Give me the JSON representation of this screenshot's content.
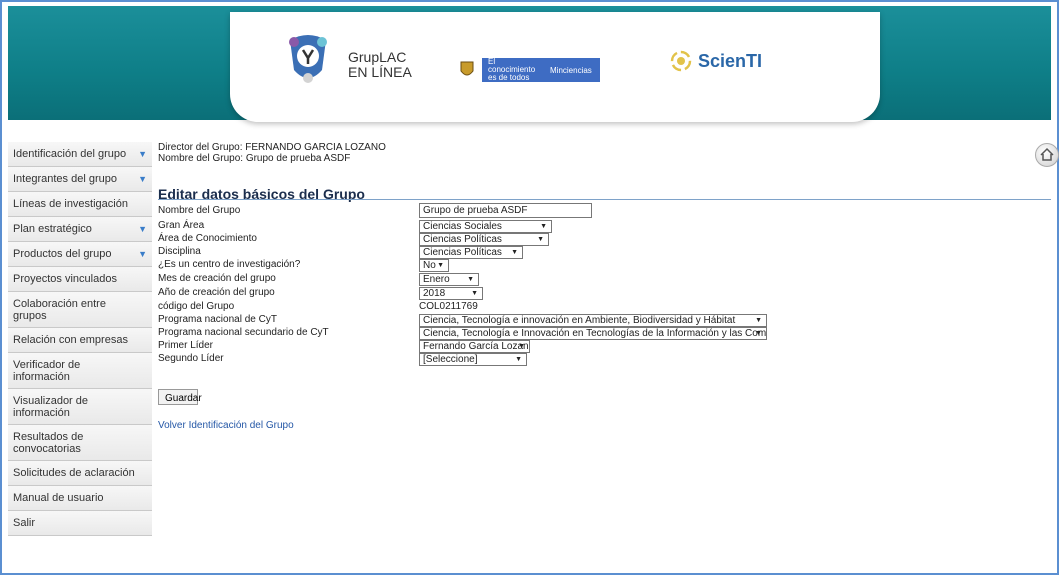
{
  "header": {
    "app_line1": "GrupLAC",
    "app_line2": "EN LÍNEA",
    "gov_slogan": "El conocimiento es de todos",
    "gov_ministry": "Minciencias",
    "scienti_name": "ScienTI"
  },
  "sidebar": {
    "items": [
      {
        "label": "Identificación del grupo",
        "has_chevron": true
      },
      {
        "label": "Integrantes del grupo",
        "has_chevron": true
      },
      {
        "label": "Líneas de investigación",
        "has_chevron": false
      },
      {
        "label": "Plan estratégico",
        "has_chevron": true
      },
      {
        "label": "Productos del grupo",
        "has_chevron": true
      },
      {
        "label": "Proyectos vinculados",
        "has_chevron": false
      },
      {
        "label": "Colaboración entre grupos",
        "has_chevron": false
      },
      {
        "label": "Relación con empresas",
        "has_chevron": false
      },
      {
        "label": "Verificador de información",
        "has_chevron": false
      },
      {
        "label": "Visualizador de información",
        "has_chevron": false
      },
      {
        "label": "Resultados de convocatorias",
        "has_chevron": false
      },
      {
        "label": "Solicitudes de aclaración",
        "has_chevron": false
      },
      {
        "label": "Manual de usuario",
        "has_chevron": false
      },
      {
        "label": "Salir",
        "has_chevron": false
      }
    ]
  },
  "group_info": {
    "director_label": "Director del Grupo:",
    "director_value": "FERNANDO GARCIA LOZANO",
    "name_label": "Nombre del Grupo:",
    "name_value": "Grupo de prueba ASDF"
  },
  "form": {
    "title": "Editar datos básicos del Grupo",
    "fields": {
      "nombre": {
        "label": "Nombre del Grupo",
        "value": "Grupo de prueba ASDF"
      },
      "gran_area": {
        "label": "Gran Área",
        "value": "Ciencias Sociales"
      },
      "area": {
        "label": "Área de Conocimiento",
        "value": "Ciencias Políticas"
      },
      "disciplina": {
        "label": "Disciplina",
        "value": "Ciencias Políticas"
      },
      "centro": {
        "label": "¿Es un centro de investigación?",
        "value": "No"
      },
      "mes": {
        "label": "Mes de creación del grupo",
        "value": "Enero"
      },
      "anio": {
        "label": "Año de creación del grupo",
        "value": "2018"
      },
      "codigo": {
        "label": "código del Grupo",
        "value": "COL0211769"
      },
      "programa": {
        "label": "Programa nacional de CyT",
        "value": "Ciencia, Tecnología e innovación en Ambiente, Biodiversidad y Hábitat"
      },
      "programa_sec": {
        "label": "Programa nacional secundario de CyT",
        "value": "Ciencia, Tecnología e Innovación en Tecnologías de la Información y las Comunicaciones"
      },
      "primer_lider": {
        "label": "Primer Líder",
        "value": "Fernando García Lozano"
      },
      "segundo_lider": {
        "label": "Segundo Líder",
        "value": "[Seleccione]"
      }
    },
    "save_label": "Guardar",
    "back_link": "Volver Identificación del Grupo"
  },
  "colors": {
    "header": "#0e7e87",
    "accent": "#3a7dc9",
    "link": "#2457a6"
  },
  "icons": {
    "home": "home-icon",
    "chevron": "chevron-down-icon"
  }
}
